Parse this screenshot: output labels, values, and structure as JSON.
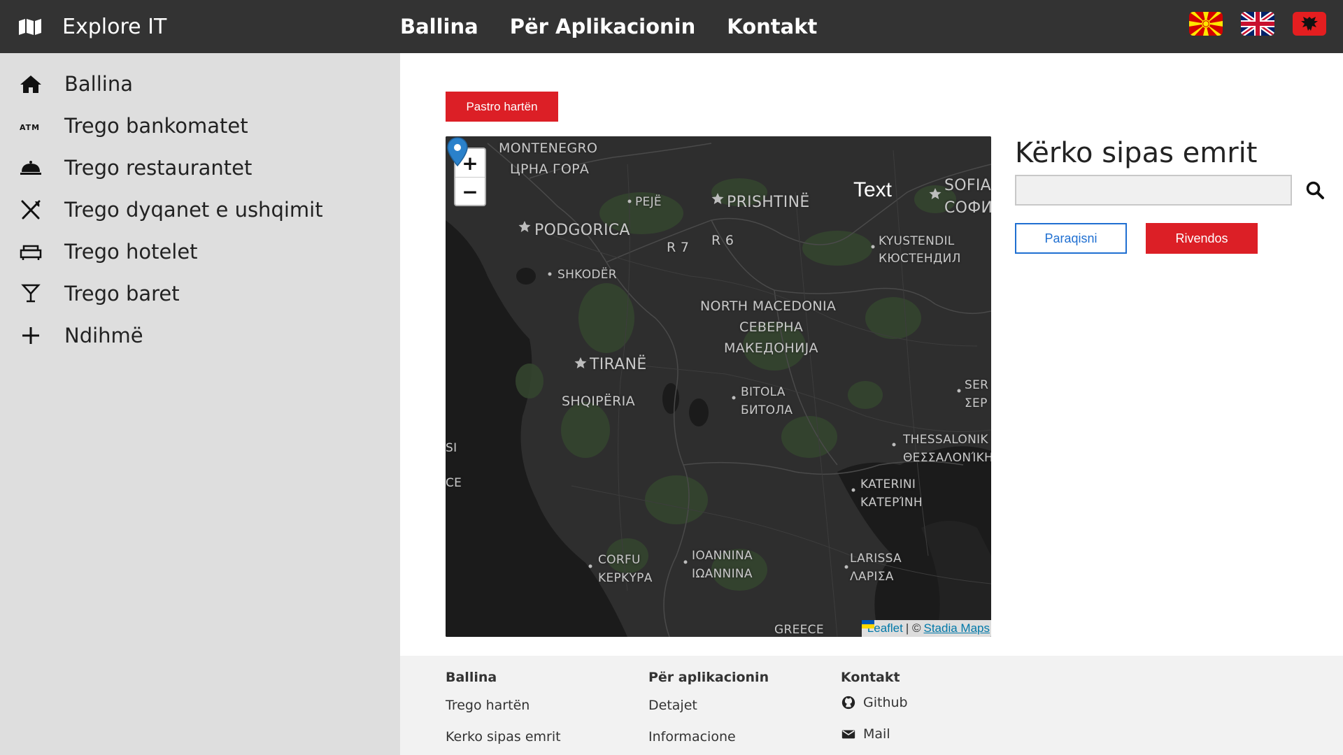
{
  "navbar": {
    "brand_icon": "map-icon",
    "brand_title": "Explore IT",
    "links": [
      "Ballina",
      "Për Aplikacionin",
      "Kontakt"
    ],
    "flags": [
      "macedonia-flag",
      "uk-flag",
      "albania-flag"
    ]
  },
  "sidebar": {
    "items": [
      {
        "icon": "home-icon",
        "label": "Ballina"
      },
      {
        "icon": "atm-icon",
        "label": "Trego bankomatet"
      },
      {
        "icon": "cloche-icon",
        "label": "Trego restaurantet"
      },
      {
        "icon": "utensils-icon",
        "label": "Trego dyqanet e ushqimit"
      },
      {
        "icon": "sofa-icon",
        "label": "Trego hotelet"
      },
      {
        "icon": "cocktail-icon",
        "label": "Trego baret"
      },
      {
        "icon": "plus-icon",
        "label": "Ndihmë"
      }
    ]
  },
  "main": {
    "clear_map_label": "Pastro hartën",
    "map": {
      "zoom_in": "+",
      "zoom_out": "−",
      "overlay_text": "Text",
      "labels": {
        "montenegro": "MONTENEGRO",
        "montenegro_cyr": "ЦРНА ГОРА",
        "peje": "PEJË",
        "prishtine": "PRISHTINË",
        "sofia": "SOFIA",
        "sofia_cyr": "СОФИ",
        "podgorica": "PODGORICA",
        "r7": "R 7",
        "r6": "R 6",
        "kyustendil": "KYUSTENDIL",
        "kyustendil_cyr": "КЮСТЕНДИЛ",
        "shkoder": "SHKODËR",
        "north_macedonia": "NORTH MACEDONIA",
        "severna": "СЕВЕРНА",
        "makedonija": "МАКЕДОНИЈА",
        "tirane": "TIRANË",
        "shqiperia": "SHQIPËRIA",
        "bitola": "BITOLA",
        "bitola_cyr": "БИТОЛА",
        "serres": "SER",
        "serres_gr": "ΣΕΡ",
        "thessaloniki": "THESSALONIK",
        "thessaloniki_gr": "ΘΕΣΣΑΛΟΝΊΚΗ",
        "si": "SI",
        "ce": "CE",
        "katerini": "KATERINI",
        "katerini_gr": "ΚΑΤΕΡΊΝΗ",
        "corfu": "CORFU",
        "corfu_gr": "ΚΕΡΚΥΡΑ",
        "ioannina": "IOANNINA",
        "ioannina_gr": "ΙΩΑΝΝΙΝΑ",
        "larissa": "LARISSA",
        "larissa_gr": "ΛΑΡΙΣΑ",
        "greece": "GREECE"
      },
      "attribution": {
        "leaflet": "Leaflet",
        "separator": "| ©",
        "stadia": "Stadia Maps"
      }
    },
    "search": {
      "title": "Kërko sipas emrit",
      "input_value": "",
      "input_placeholder": "",
      "show_label": "Paraqisni",
      "reset_label": "Rivendos"
    }
  },
  "footer": {
    "columns": [
      {
        "heading": "Ballina",
        "links": [
          "Trego hartën",
          "Kerko sipas emrit"
        ]
      },
      {
        "heading": "Për aplikacionin",
        "links": [
          "Detajet",
          "Informacione"
        ]
      },
      {
        "heading": "Kontakt",
        "links": [
          "Github",
          "Mail"
        ]
      }
    ]
  },
  "colors": {
    "navbar_bg": "#333333",
    "sidebar_bg": "#dedede",
    "accent_red": "#dc1f26",
    "accent_blue": "#1f6fd1",
    "map_bg": "#262626"
  }
}
